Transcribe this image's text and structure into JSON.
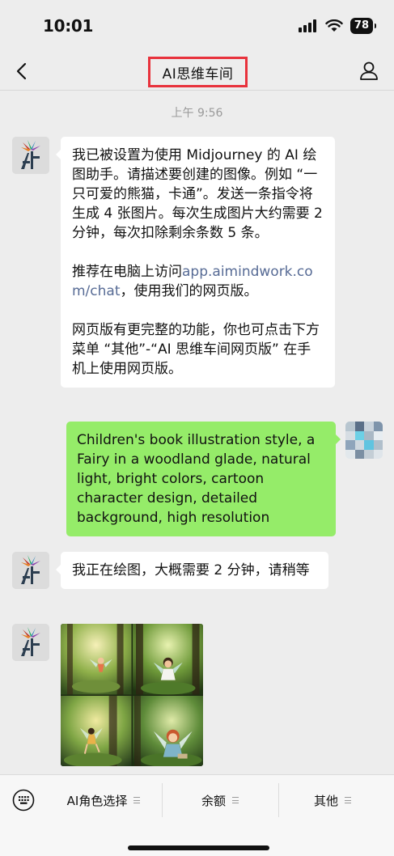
{
  "status_bar": {
    "time": "10:01",
    "battery": "78"
  },
  "nav": {
    "title": "AI思维车间"
  },
  "chat": {
    "timestamp": "上午 9:56",
    "messages": [
      {
        "sender": "bot",
        "paragraphs": [
          "我已被设置为使用 Midjourney 的 AI 绘图助手。请描述要创建的图像。例如 “一只可爱的熊猫，卡通”。发送一条指令将生成 4 张图片。每次生成图片大约需要 2 分钟，每次扣除剩余条数 5 条。",
          "推荐在电脑上访问",
          "网页版有更完整的功能，你也可点击下方菜单 “其他”-“AI 思维车间网页版” 在手机上使用网页版。"
        ],
        "link": "app.aimindwork.com/chat",
        "link_suffix": "，使用我们的网页版。"
      },
      {
        "sender": "user",
        "text": "Children's book illustration style, a Fairy in a woodland glade, natural light, bright colors, cartoon character design, detailed background, high resolution"
      },
      {
        "sender": "bot",
        "text": "我正在绘图，大概需要 2 分钟，请稍等"
      }
    ]
  },
  "bottom_menu": {
    "items": [
      {
        "label": "AI角色选择"
      },
      {
        "label": "余额"
      },
      {
        "label": "其他"
      }
    ]
  },
  "colors": {
    "title_highlight": "#e8323c",
    "user_bubble": "#95ec69",
    "link": "#576b95"
  }
}
